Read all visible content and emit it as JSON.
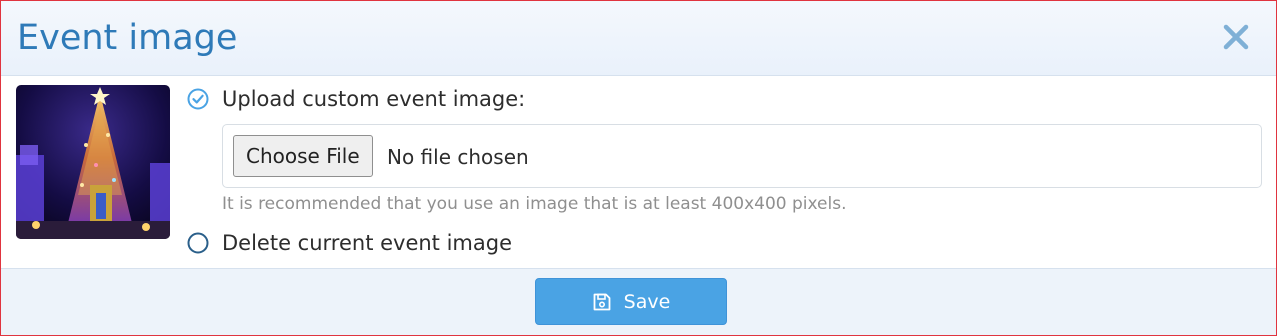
{
  "dialog": {
    "title": "Event image",
    "close_icon": "close-icon"
  },
  "options": {
    "upload": {
      "label": "Upload custom event image:",
      "selected": true,
      "icon": "check-circle-icon"
    },
    "delete": {
      "label": "Delete current event image",
      "selected": false,
      "icon": "radio-empty-icon"
    }
  },
  "file_input": {
    "button_label": "Choose File",
    "status": "No file chosen"
  },
  "hint": "It is recommended that you use an image that is at least 400x400 pixels.",
  "footer": {
    "save_label": "Save",
    "save_icon": "floppy-disk-icon"
  },
  "colors": {
    "title": "#2e7ab8",
    "accent": "#4aa3e4",
    "close": "#7fb0d6",
    "frame_border": "#e0343f"
  }
}
